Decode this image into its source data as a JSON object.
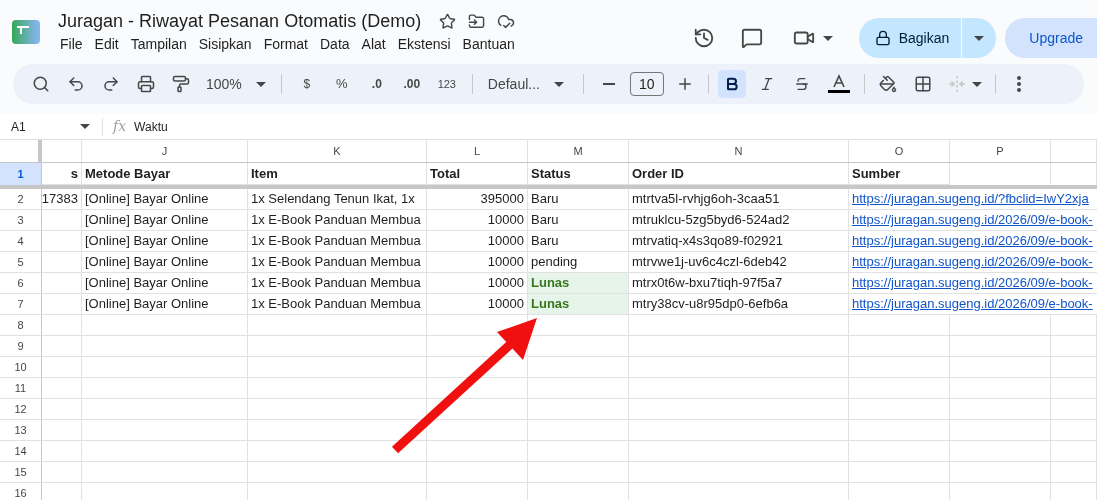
{
  "document": {
    "title": "Juragan - Riwayat Pesanan Otomatis (Demo)",
    "menu": [
      "File",
      "Edit",
      "Tampilan",
      "Sisipkan",
      "Format",
      "Data",
      "Alat",
      "Ekstensi",
      "Bantuan"
    ],
    "share_button": "Bagikan",
    "upgrade_button": "Upgrade"
  },
  "toolbar": {
    "zoom": "100%",
    "currency": "$",
    "percent": "%",
    "decrease_decimals": ".0",
    "increase_decimals": ".00",
    "number_format": "123",
    "font": "Defaul...",
    "font_size": "10",
    "bold": true,
    "italic": false,
    "strikethrough": false
  },
  "formula_bar": {
    "cell": "A1",
    "function_label": "fx",
    "formula": "Waktu"
  },
  "columns": [
    "",
    "J",
    "K",
    "L",
    "M",
    "N",
    "O",
    "P",
    ""
  ],
  "header_row": {
    "number": "1",
    "selected": true,
    "cells": [
      "s",
      "Metode Bayar",
      "Item",
      "Total",
      "Status",
      "Order ID",
      "Sumber"
    ]
  },
  "rows": [
    {
      "number": "2",
      "cells": [
        "17383",
        "[Online] Bayar Online",
        "1x Selendang Tenun Ikat, 1x",
        "395000",
        "Baru",
        "mtrtva5l-rvhjg6oh-3caa51",
        "https://juragan.sugeng.id/?fbclid=IwY2xja"
      ],
      "paid": false
    },
    {
      "number": "3",
      "cells": [
        "",
        "[Online] Bayar Online",
        "1x E-Book Panduan Membua",
        "10000",
        "Baru",
        "mtruklcu-5zg5byd6-524ad2",
        "https://juragan.sugeng.id/2026/09/e-book-"
      ],
      "paid": false
    },
    {
      "number": "4",
      "cells": [
        "",
        "[Online] Bayar Online",
        "1x E-Book Panduan Membua",
        "10000",
        "Baru",
        "mtrvatiq-x4s3qo89-f02921",
        "https://juragan.sugeng.id/2026/09/e-book-"
      ],
      "paid": false
    },
    {
      "number": "5",
      "cells": [
        "",
        "[Online] Bayar Online",
        "1x E-Book Panduan Membua",
        "10000",
        "pending",
        "mtrvwe1j-uv6c4czl-6deb42",
        "https://juragan.sugeng.id/2026/09/e-book-"
      ],
      "paid": false
    },
    {
      "number": "6",
      "cells": [
        "",
        "[Online] Bayar Online",
        "1x E-Book Panduan Membua",
        "10000",
        "Lunas",
        "mtrx0t6w-bxu7tiqh-97f5a7",
        "https://juragan.sugeng.id/2026/09/e-book-"
      ],
      "paid": true
    },
    {
      "number": "7",
      "cells": [
        "",
        "[Online] Bayar Online",
        "1x E-Book Panduan Membua",
        "10000",
        "Lunas",
        "mtry38cv-u8r95dp0-6efb6a",
        "https://juragan.sugeng.id/2026/09/e-book-"
      ],
      "paid": true
    }
  ],
  "empty_rows": [
    "8",
    "9",
    "10",
    "11",
    "12",
    "13",
    "14",
    "15",
    "16"
  ]
}
